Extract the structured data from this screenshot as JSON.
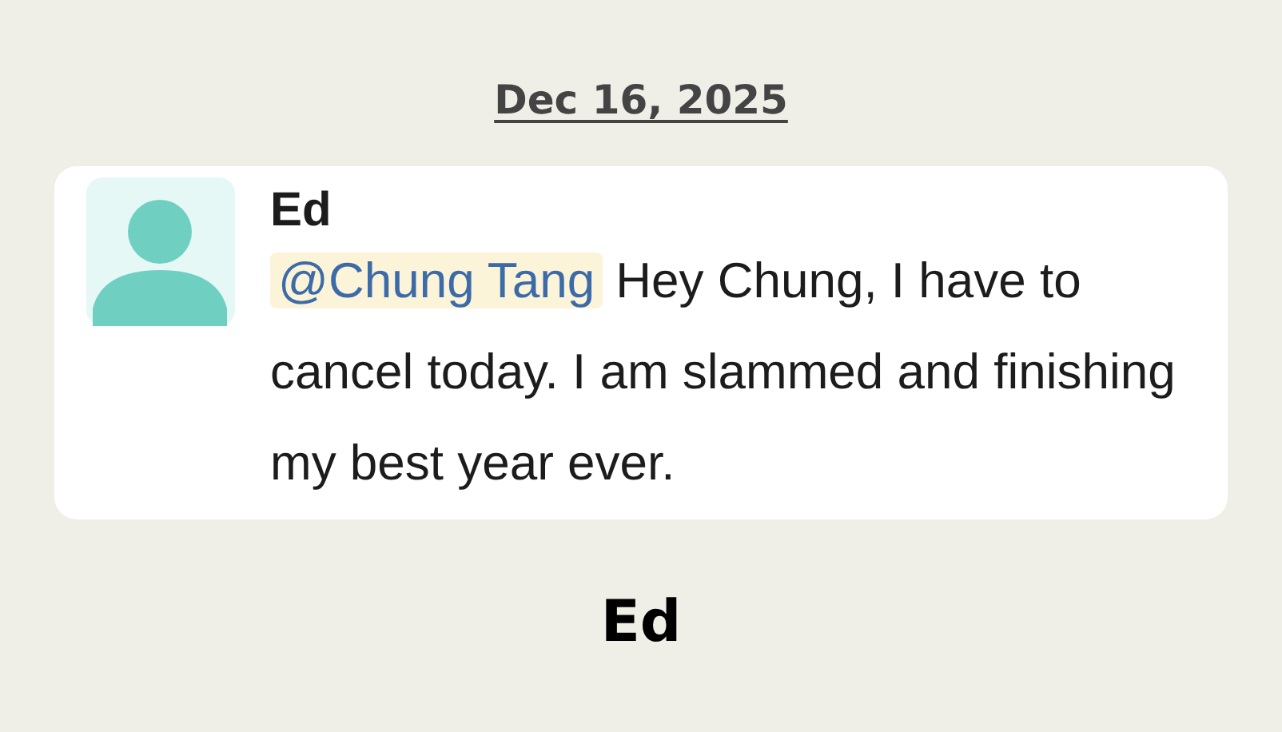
{
  "date": "Dec 16, 2025",
  "message": {
    "author": "Ed",
    "mention": "@Chung Tang",
    "text": "Hey Chung, I have to cancel today. I am slammed and finishing my best year ever."
  },
  "footer_name": "Ed"
}
